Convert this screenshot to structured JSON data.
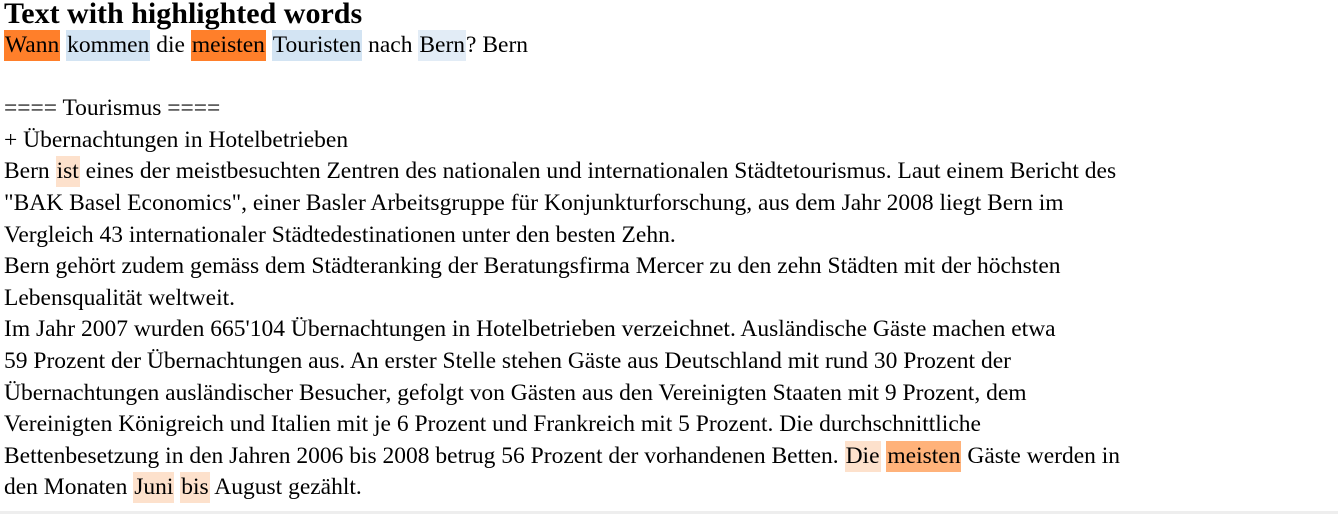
{
  "title": "Text with highlighted words",
  "highlight_colors": {
    "strong_orange": "#ff7f2a",
    "medium_orange": "#ffb27a",
    "light_peach": "#fde1cc",
    "light_blue": "#d3e4f3",
    "pale_blue": "#e2ecf6"
  },
  "lines": [
    [
      {
        "text": "Wann",
        "hl": "#ff7f2a"
      },
      {
        "text": " "
      },
      {
        "text": "kommen",
        "hl": "#d3e4f3"
      },
      {
        "text": " die "
      },
      {
        "text": "meisten",
        "hl": "#ff7f2a"
      },
      {
        "text": " "
      },
      {
        "text": "Touristen",
        "hl": "#d3e4f3"
      },
      {
        "text": " nach "
      },
      {
        "text": "Bern",
        "hl": "#e2ecf6"
      },
      {
        "text": "? Bern"
      }
    ],
    [],
    [
      {
        "text": "==== Tourismus ===="
      }
    ],
    [
      {
        "text": "+ Übernachtungen in Hotelbetrieben"
      }
    ],
    [
      {
        "text": "Bern "
      },
      {
        "text": "ist",
        "hl": "#fde1cc"
      },
      {
        "text": " eines der meistbesuchten Zentren des nationalen und internationalen Städtetourismus. Laut einem Bericht des"
      }
    ],
    [
      {
        "text": "\"BAK Basel Economics\", einer Basler Arbeitsgruppe für Konjunkturforschung, aus dem Jahr 2008 liegt Bern im"
      }
    ],
    [
      {
        "text": "Vergleich 43 internationaler Städtedestinationen unter den besten Zehn."
      }
    ],
    [
      {
        "text": "Bern gehört zudem gemäss dem Städteranking der Beratungsfirma Mercer zu den zehn Städten mit der höchsten"
      }
    ],
    [
      {
        "text": "Lebensqualität weltweit."
      }
    ],
    [
      {
        "text": "Im Jahr 2007 wurden 665'104 Übernachtungen in Hotelbetrieben verzeichnet. Ausländische Gäste machen etwa"
      }
    ],
    [
      {
        "text": "59 Prozent der Übernachtungen aus. An erster Stelle stehen Gäste aus Deutschland mit rund 30 Prozent der"
      }
    ],
    [
      {
        "text": "Übernachtungen ausländischer Besucher, gefolgt von Gästen aus den Vereinigten Staaten mit 9 Prozent, dem"
      }
    ],
    [
      {
        "text": "Vereinigten Königreich und Italien mit je 6 Prozent und Frankreich mit 5 Prozent. Die durchschnittliche"
      }
    ],
    [
      {
        "text": "Bettenbesetzung in den Jahren 2006 bis 2008 betrug 56 Prozent der vorhandenen Betten. "
      },
      {
        "text": "Die",
        "hl": "#fde1cc"
      },
      {
        "text": " "
      },
      {
        "text": "meisten",
        "hl": "#ffb27a"
      },
      {
        "text": " Gäste werden in"
      }
    ],
    [
      {
        "text": "den Monaten "
      },
      {
        "text": "Juni",
        "hl": "#fde1cc"
      },
      {
        "text": " "
      },
      {
        "text": "bis",
        "hl": "#fde1cc"
      },
      {
        "text": " August gezählt."
      }
    ]
  ]
}
